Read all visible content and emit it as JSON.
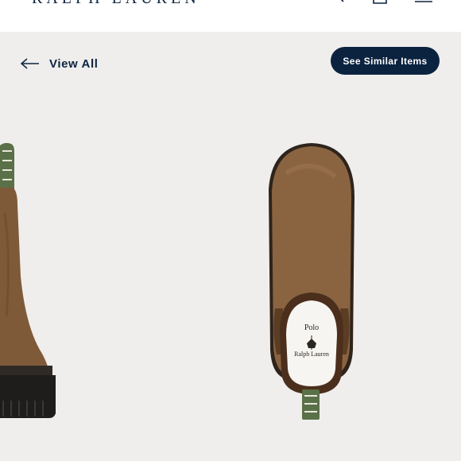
{
  "header": {
    "logo_text": "RALPH LAUREN",
    "icons": [
      "search-icon",
      "shopping-bag-icon",
      "menu-icon"
    ]
  },
  "nav": {
    "back_label": "View All",
    "back_icon": "arrow-left-icon"
  },
  "actions": {
    "similar_label": "See Similar Items"
  },
  "product_images": {
    "alt_side": "Suede Chelsea boot side view",
    "alt_top": "Suede Chelsea boot top view"
  },
  "insole": {
    "brand_line1": "Polo",
    "brand_line2": "Ralph Lauren"
  },
  "colors": {
    "navy": "#0c2340",
    "background": "#efeeec",
    "suede": "#8a6440",
    "pull_tab_green": "#5a7048"
  }
}
